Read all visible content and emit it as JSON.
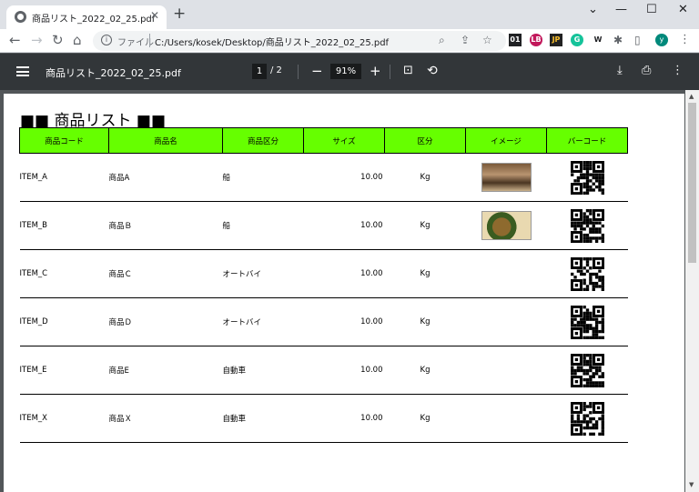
{
  "tab": {
    "title": "商品リスト_2022_02_25.pdf",
    "close": "✕",
    "new_tab": "+"
  },
  "window_controls": {
    "minimize": "—",
    "maximize": "☐",
    "close": "✕",
    "dropdown": "⌄"
  },
  "address": {
    "scheme_label": "ファイル",
    "url": "C:/Users/kosek/Desktop/商品リスト_2022_02_25.pdf"
  },
  "extensions": [
    "01",
    "LB",
    "JP",
    "G",
    "W"
  ],
  "profile_initial": "y",
  "pdf": {
    "title": "商品リスト_2022_02_25.pdf",
    "current_page": "1",
    "total_pages": "/ 2",
    "zoom": "91%"
  },
  "document": {
    "heading": "■■ 商品リスト ■■",
    "columns": [
      "商品コード",
      "商品名",
      "商品区分",
      "サイズ",
      "区分",
      "イメージ",
      "バーコード"
    ],
    "rows": [
      {
        "code": "ITEM_A",
        "name": "商品A",
        "category": "船",
        "size": "10.00",
        "unit": "Kg",
        "image": "painting-supper"
      },
      {
        "code": "ITEM_B",
        "name": "商品Ｂ",
        "category": "船",
        "size": "10.00",
        "unit": "Kg",
        "image": "painting-fruit"
      },
      {
        "code": "ITEM_C",
        "name": "商品Ｃ",
        "category": "オートバイ",
        "size": "10.00",
        "unit": "Kg",
        "image": ""
      },
      {
        "code": "ITEM_D",
        "name": "商品Ｄ",
        "category": "オートバイ",
        "size": "10.00",
        "unit": "Kg",
        "image": ""
      },
      {
        "code": "ITEM_E",
        "name": "商品E",
        "category": "自動車",
        "size": "10.00",
        "unit": "Kg",
        "image": ""
      },
      {
        "code": "ITEM_X",
        "name": "商品Ｘ",
        "category": "自動車",
        "size": "10.00",
        "unit": "Kg",
        "image": ""
      }
    ]
  },
  "colors": {
    "header_fill": "#66ff00",
    "pdf_toolbar": "#323639",
    "viewer_bg": "#525659"
  }
}
